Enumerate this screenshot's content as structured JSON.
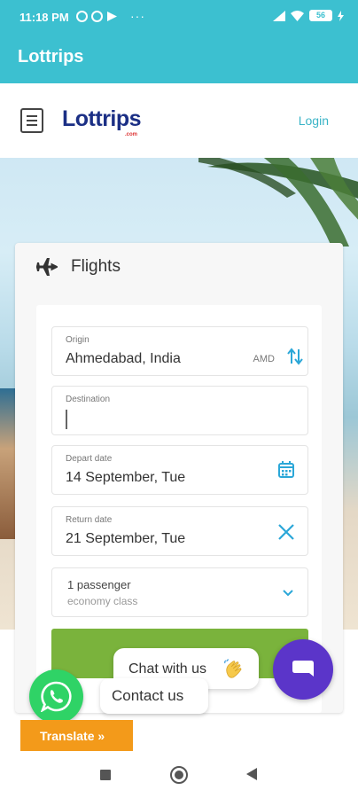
{
  "status_bar": {
    "time": "11:18 PM",
    "dots": "···",
    "battery": "56"
  },
  "app_bar": {
    "title": "Lottrips"
  },
  "header": {
    "logo": "Lottrips",
    "logo_sub": ".com",
    "login": "Login"
  },
  "card": {
    "title": "Flights",
    "origin": {
      "label": "Origin",
      "value": "Ahmedabad, India",
      "code": "AMD"
    },
    "destination": {
      "label": "Destination",
      "value": ""
    },
    "depart": {
      "label": "Depart date",
      "value": "14 September, Tue"
    },
    "return": {
      "label": "Return date",
      "value": "21 September, Tue"
    },
    "passengers": {
      "count": "1 passenger",
      "class": "economy class"
    }
  },
  "widgets": {
    "chat_bubble": "Chat with us",
    "contact": "Contact us",
    "translate": "Translate »"
  },
  "colors": {
    "accent": "#3cc0d0",
    "brand": "#1b2f85",
    "search": "#7ab33c",
    "chat": "#5b35c9",
    "whatsapp": "#2fd366",
    "translate": "#f39a1a"
  }
}
